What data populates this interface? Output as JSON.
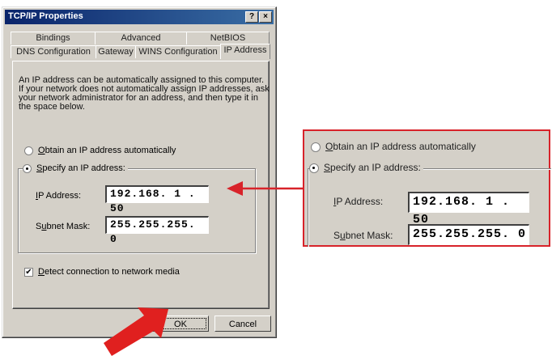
{
  "dialog": {
    "title": "TCP/IP Properties",
    "help_button": "?",
    "close_button": "×",
    "tabs_row1": [
      "Bindings",
      "Advanced",
      "NetBIOS"
    ],
    "tabs_row2": [
      "DNS Configuration",
      "Gateway",
      "WINS Configuration",
      "IP Address"
    ],
    "active_tab": "IP Address",
    "description_lines": [
      "An IP address can be automatically assigned to this computer.",
      "If your network does not automatically assign IP addresses, ask",
      "your network administrator for an address, and then type it in",
      "the space below."
    ],
    "obtain_auto": {
      "prefix": "",
      "accel": "O",
      "rest": "btain an IP address automatically",
      "selected": false
    },
    "specify": {
      "accel": "S",
      "rest": "pecify an IP address:",
      "selected": true
    },
    "ip_label": {
      "accel": "I",
      "rest": "P Address:"
    },
    "ip_value": "192.168. 1  . 50",
    "subnet_label": {
      "pre": "S",
      "accel": "u",
      "rest": "bnet Mask:"
    },
    "subnet_value": "255.255.255. 0",
    "detect": {
      "accel": "D",
      "rest": "etect connection to network media",
      "checked": true,
      "mark": "✔"
    },
    "ok_label": "OK",
    "cancel_label": "Cancel"
  },
  "zoom": {
    "obtain_auto": {
      "accel": "O",
      "rest": "btain an IP address automatically"
    },
    "specify": {
      "accel": "S",
      "rest": "pecify an IP address:"
    },
    "ip_label": {
      "accel": "I",
      "rest": "P Address:"
    },
    "ip_value": "192.168. 1  . 50",
    "subnet_label": {
      "pre": "S",
      "accel": "u",
      "rest": "bnet Mask:"
    },
    "subnet_value": "255.255.255. 0"
  },
  "colors": {
    "accent_red": "#d8232a",
    "title_start": "#0a246a",
    "title_end": "#3a6ea5"
  }
}
